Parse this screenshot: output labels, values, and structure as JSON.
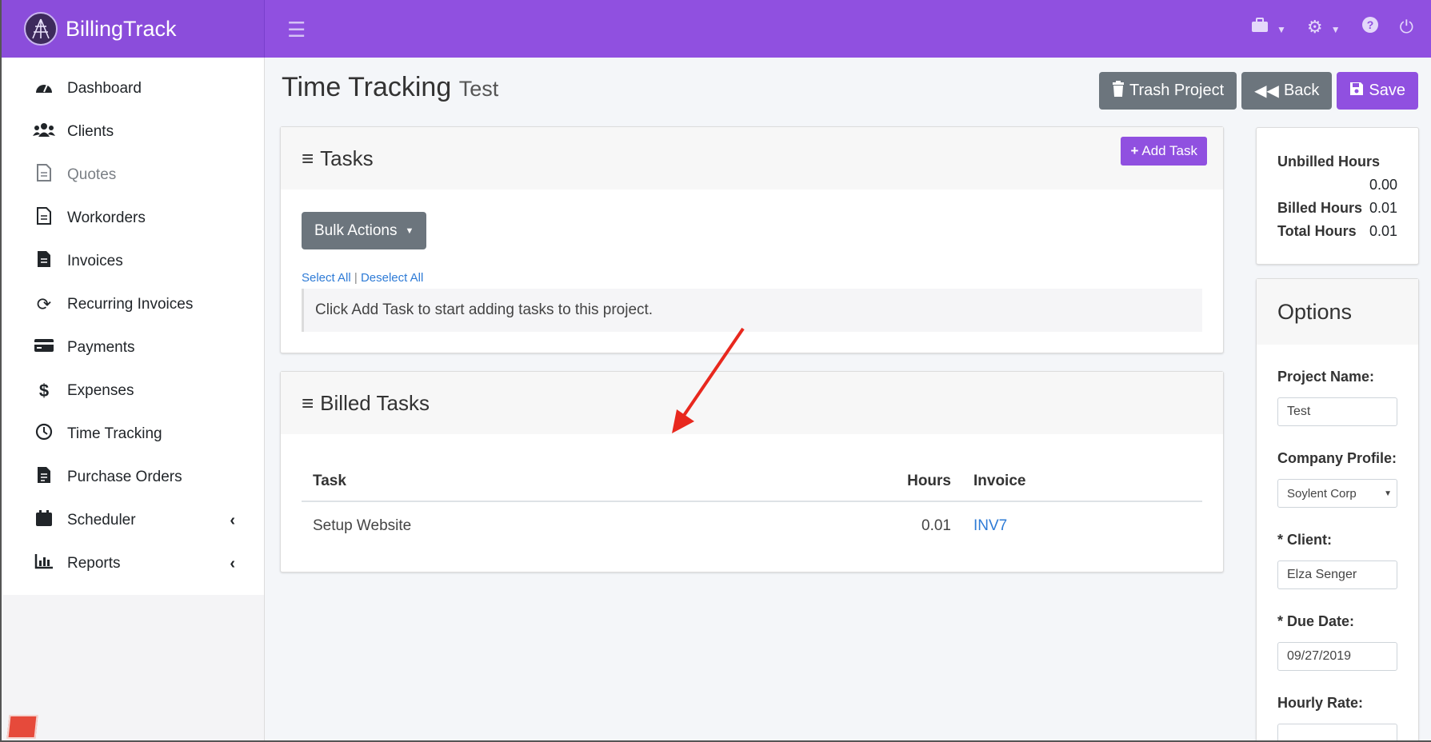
{
  "brand": {
    "name": "BillingTrack"
  },
  "topbar": {
    "icons": [
      "briefcase-icon",
      "gear-icon",
      "help-icon",
      "power-icon"
    ]
  },
  "sidebar": {
    "items": [
      {
        "label": "Dashboard",
        "icon": "dashboard-icon"
      },
      {
        "label": "Clients",
        "icon": "users-icon"
      },
      {
        "label": "Quotes",
        "icon": "file-icon"
      },
      {
        "label": "Workorders",
        "icon": "file-text-icon"
      },
      {
        "label": "Invoices",
        "icon": "file-solid-icon"
      },
      {
        "label": "Recurring Invoices",
        "icon": "sync-icon"
      },
      {
        "label": "Payments",
        "icon": "credit-card-icon"
      },
      {
        "label": "Expenses",
        "icon": "dollar-icon"
      },
      {
        "label": "Time Tracking",
        "icon": "clock-icon"
      },
      {
        "label": "Purchase Orders",
        "icon": "file-invoice-icon"
      },
      {
        "label": "Scheduler",
        "icon": "calendar-icon"
      },
      {
        "label": "Reports",
        "icon": "chart-icon"
      }
    ]
  },
  "page": {
    "title": "Time Tracking",
    "subtitle": "Test"
  },
  "header_buttons": {
    "trash": "Trash Project",
    "back": "Back",
    "save": "Save"
  },
  "tasks_card": {
    "title": "Tasks",
    "add_task": "Add Task",
    "bulk_actions": "Bulk Actions",
    "select_all": "Select All",
    "separator": "|",
    "deselect_all": "Deselect All",
    "empty_message": "Click Add Task to start adding tasks to this project."
  },
  "billed_card": {
    "title": "Billed Tasks",
    "columns": [
      "Task",
      "Hours",
      "Invoice"
    ],
    "rows": [
      {
        "task": "Setup Website",
        "hours": "0.01",
        "invoice": "INV7"
      }
    ]
  },
  "stats": {
    "unbilled_label": "Unbilled Hours",
    "unbilled_value": "0.00",
    "billed_label": "Billed Hours",
    "billed_value": "0.01",
    "total_label": "Total Hours",
    "total_value": "0.01"
  },
  "options": {
    "title": "Options",
    "project_name_label": "Project Name:",
    "project_name_value": "Test",
    "company_profile_label": "Company Profile:",
    "company_profile_value": "Soylent Corp",
    "client_label": "* Client:",
    "client_value": "Elza Senger",
    "due_date_label": "* Due Date:",
    "due_date_value": "09/27/2019",
    "hourly_rate_label": "Hourly Rate:"
  },
  "colors": {
    "accent": "#9050e0",
    "button_gray": "#6c757d",
    "link": "#2e7bd6",
    "annotation_arrow": "#e8281e"
  }
}
